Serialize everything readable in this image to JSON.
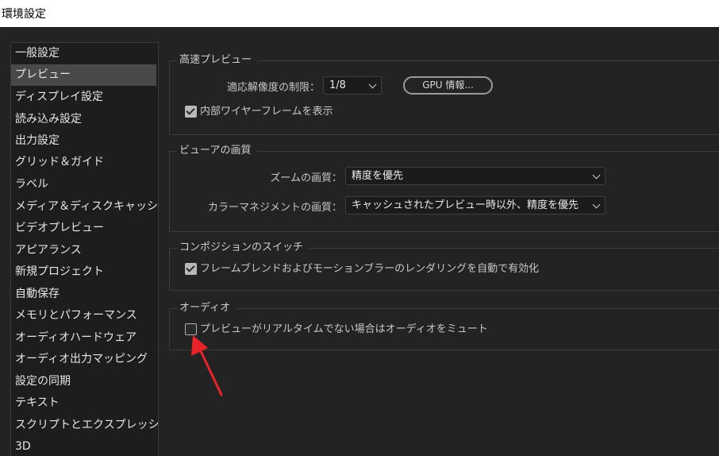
{
  "window": {
    "title": "環境設定"
  },
  "sidebar": {
    "items": [
      {
        "label": "一般設定"
      },
      {
        "label": "プレビュー",
        "selected": true
      },
      {
        "label": "ディスプレイ設定"
      },
      {
        "label": "読み込み設定"
      },
      {
        "label": "出力設定"
      },
      {
        "label": "グリッド＆ガイド"
      },
      {
        "label": "ラベル"
      },
      {
        "label": "メディア＆ディスクキャッシュ"
      },
      {
        "label": "ビデオプレビュー"
      },
      {
        "label": "アピアランス"
      },
      {
        "label": "新規プロジェクト"
      },
      {
        "label": "自動保存"
      },
      {
        "label": "メモリとパフォーマンス"
      },
      {
        "label": "オーディオハードウェア"
      },
      {
        "label": "オーディオ出力マッピング"
      },
      {
        "label": "設定の同期"
      },
      {
        "label": "テキスト"
      },
      {
        "label": "スクリプトとエクスプレッション"
      },
      {
        "label": "3D"
      }
    ]
  },
  "fast_preview": {
    "legend": "高速プレビュー",
    "resolution_label": "適応解像度の制限：",
    "resolution_value": "1/8",
    "gpu_button": "GPU 情報...",
    "wireframe_checkbox": {
      "label": "内部ワイヤーフレームを表示",
      "checked": true
    }
  },
  "viewer_quality": {
    "legend": "ビューアの画質",
    "zoom_label": "ズームの画質：",
    "zoom_value": "精度を優先",
    "color_label": "カラーマネジメントの画質：",
    "color_value": "キャッシュされたプレビュー時以外、精度を優先"
  },
  "composition_switches": {
    "legend": "コンポジションのスイッチ",
    "frame_blend_checkbox": {
      "label": "フレームブレンドおよびモーションブラーのレンダリングを自動で有効化",
      "checked": true
    }
  },
  "audio": {
    "legend": "オーディオ",
    "mute_checkbox": {
      "label": "プレビューがリアルタイムでない場合はオーディオをミュート",
      "checked": false
    }
  },
  "colors": {
    "background": "#232323",
    "sidebar_selected": "#494949",
    "annotation_arrow": "#e8242a"
  },
  "icons": [
    "chevron-down-icon",
    "checkmark-icon",
    "red-arrow-annotation"
  ]
}
